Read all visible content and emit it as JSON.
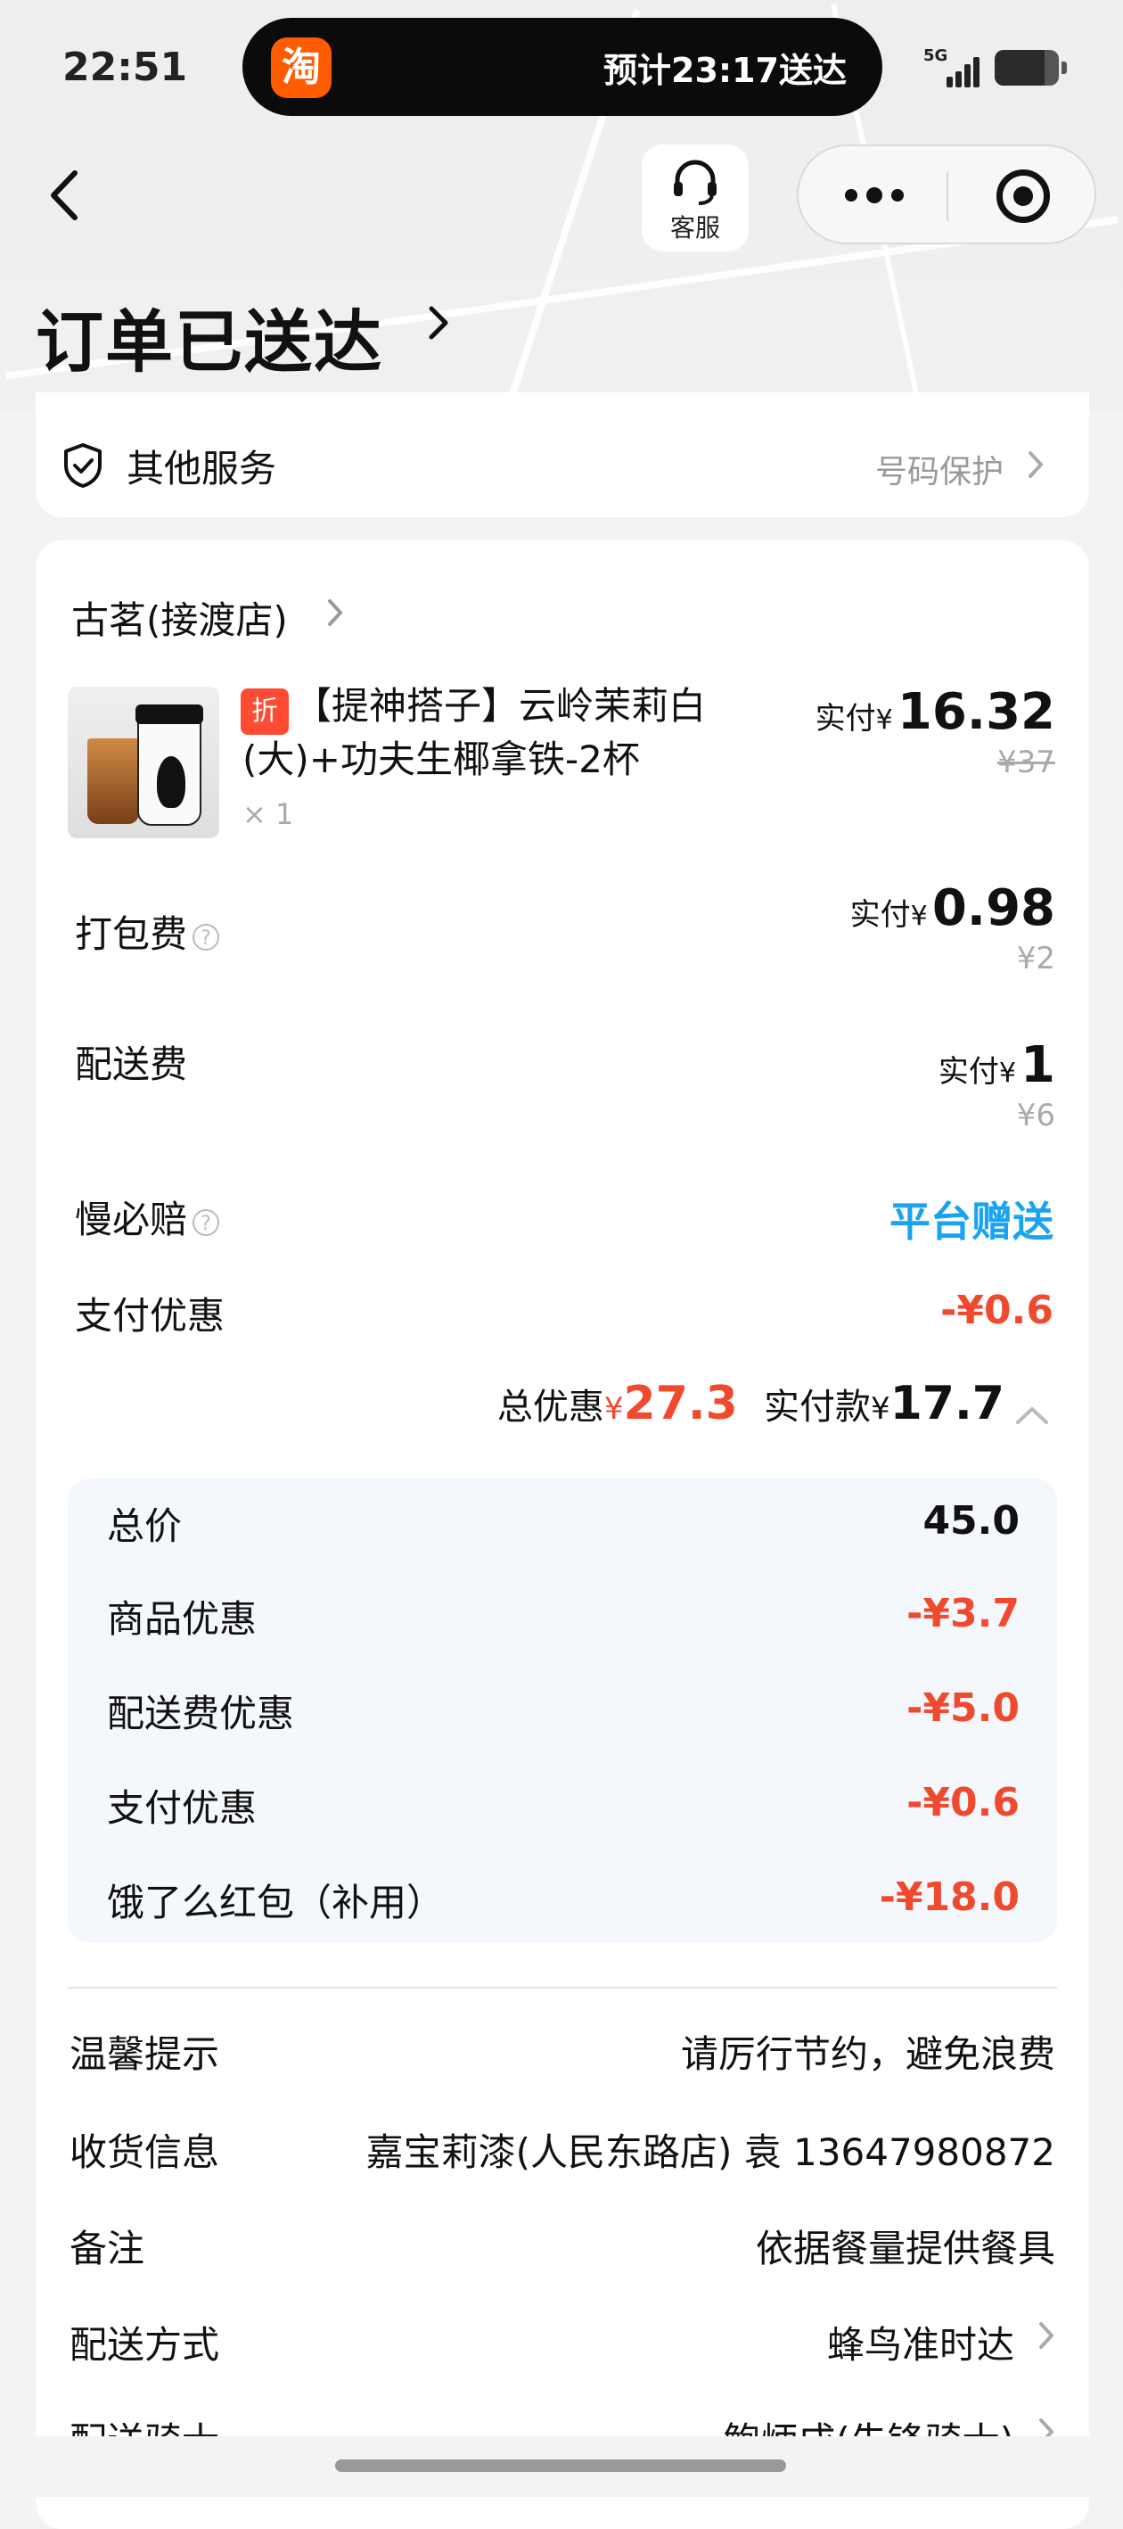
{
  "status_bar": {
    "time": "22:51",
    "app_icon_text": "淘",
    "island_text": "预计23:17送达",
    "network": "5G"
  },
  "nav": {
    "customer_service_label": "客服",
    "page_title": "订单已送达"
  },
  "service": {
    "label": "其他服务",
    "right_text": "号码保护"
  },
  "store": {
    "name": "古茗(接渡店)"
  },
  "item": {
    "tag": "折",
    "name": "【提神搭子】云岭茉莉白(大)+功夫生椰拿铁-2杯",
    "qty": "× 1",
    "pay_label": "实付",
    "yen": "¥",
    "pay_amount": "16.32",
    "original_price": "¥37"
  },
  "fees": {
    "packing": {
      "label": "打包费",
      "pay_label": "实付",
      "yen": "¥",
      "amount": "0.98",
      "original": "¥2"
    },
    "delivery": {
      "label": "配送费",
      "pay_label": "实付",
      "yen": "¥",
      "amount": "1",
      "original": "¥6"
    },
    "slow_compensation": {
      "label": "慢必赔",
      "value": "平台赠送"
    },
    "payment_discount": {
      "label": "支付优惠",
      "value": "-¥0.6"
    }
  },
  "summary": {
    "total_discount_label": "总优惠",
    "yen": "¥",
    "total_discount": "27.3",
    "paid_label": "实付款",
    "paid": "17.7"
  },
  "breakdown": [
    {
      "label": "总价",
      "value": "45.0",
      "red": false
    },
    {
      "label": "商品优惠",
      "value": "-¥3.7",
      "red": true
    },
    {
      "label": "配送费优惠",
      "value": "-¥5.0",
      "red": true
    },
    {
      "label": "支付优惠",
      "value": "-¥0.6",
      "red": true
    },
    {
      "label": "饿了么红包（补用）",
      "value": "-¥18.0",
      "red": true
    }
  ],
  "info": [
    {
      "label": "温馨提示",
      "value": "请厉行节约，避免浪费",
      "chevron": false
    },
    {
      "label": "收货信息",
      "value": "嘉宝莉漆(人民东路店) 袁 13647980872",
      "chevron": false
    },
    {
      "label": "备注",
      "value": "依据餐量提供餐具",
      "chevron": false
    },
    {
      "label": "配送方式",
      "value": "蜂鸟准时达",
      "chevron": true
    },
    {
      "label": "配送骑士",
      "value": "鲍炳成(先锋骑士)",
      "chevron": true
    }
  ],
  "colors": {
    "discount_red": "#f04a2e",
    "gift_blue": "#1aa3f0",
    "taobao_orange": "#ff5b00"
  },
  "icons": [
    "back-icon",
    "headset-icon",
    "more-icon",
    "target-icon",
    "chevron-right-icon",
    "shield-check-icon",
    "question-icon",
    "chevron-up-icon"
  ]
}
